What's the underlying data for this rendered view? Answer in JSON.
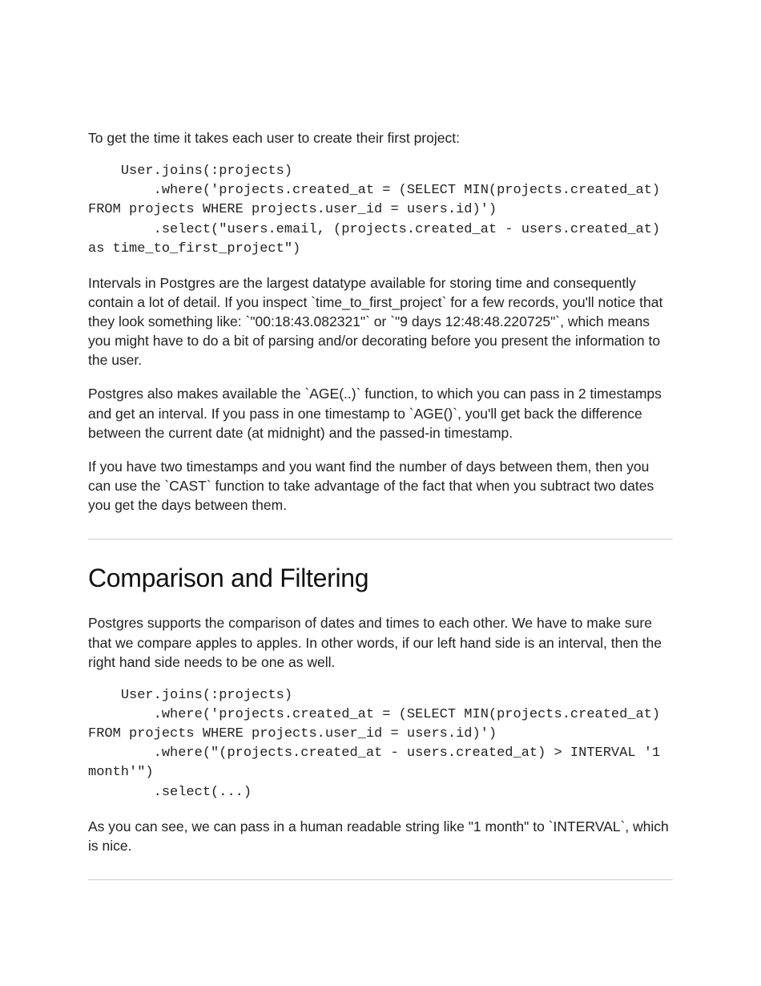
{
  "intro_p1": "To get the time it takes each user to create their first project:",
  "code1": "    User.joins(:projects)\n        .where('projects.created_at = (SELECT MIN(projects.created_at) FROM projects WHERE projects.user_id = users.id)')\n        .select(\"users.email, (projects.created_at - users.created_at) as time_to_first_project\")",
  "p2": "Intervals in Postgres are the largest datatype available for storing time and consequently contain a lot of detail. If you inspect `time_to_first_project` for a few records, you'll notice that they look something like: `\"00:18:43.082321\"` or `\"9 days 12:48:48.220725\"`, which means you might have to do a bit of parsing and/or decorating before you present the information to the user.",
  "p3": "Postgres also makes available the `AGE(..)` function, to which you can pass in 2 timestamps and get an interval. If you pass in one timestamp to `AGE()`, you'll get back the difference between the current date (at midnight) and the passed-in timestamp.",
  "p4": "If you have two timestamps and you want find the number of days between them, then you can use the `CAST` function to take advantage of the fact that when you subtract two dates you get the days between them.",
  "h2": "Comparison and Filtering",
  "p5": "Postgres supports the comparison of dates and times to each other. We have to make sure that we compare apples to apples. In other words, if our left hand side is an interval, then the right hand side needs to be one as well.",
  "code2": "    User.joins(:projects)\n        .where('projects.created_at = (SELECT MIN(projects.created_at) FROM projects WHERE projects.user_id = users.id)')\n        .where(\"(projects.created_at - users.created_at) > INTERVAL '1 month'\")\n        .select(...)",
  "p6": "As you can see, we can pass in a human readable string like \"1 month\" to `INTERVAL`, which is nice."
}
